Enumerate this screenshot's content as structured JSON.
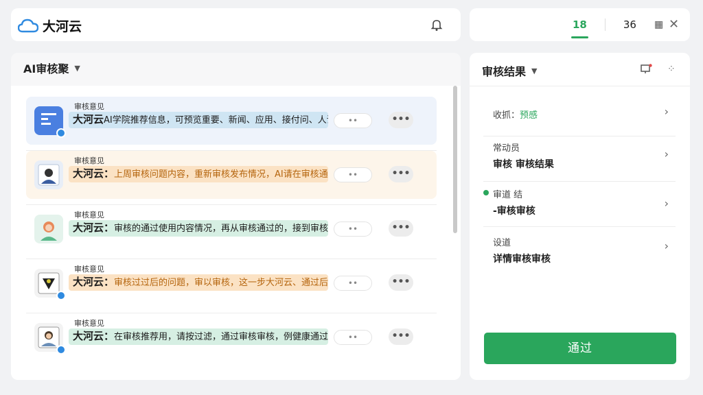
{
  "app": {
    "name": "大河云"
  },
  "top_tabs": {
    "tab1": "18",
    "tab2": "36",
    "tab3_icon": "grid-icon",
    "close": "✕"
  },
  "review_panel": {
    "title": "AI审核聚"
  },
  "rows": [
    {
      "title": "审核意见",
      "sub": "审核意见",
      "author": "大河云",
      "text": "AI学院推荐信息，可预览重要、新闻、应用、接付问、人调过审生券风员..",
      "pill": "••",
      "more": "•••",
      "tone": "blue"
    },
    {
      "title": "审核意见",
      "author": "大河云：",
      "text": "上周审核问题内容，重新审核发布情况，AI请在审核通过后审核。",
      "pill": "••",
      "more": "•••",
      "tone": "orange"
    },
    {
      "title": "审核意见",
      "author": "大河云：",
      "text": "审核的通过使用内容情况，再从审核通过的，接到审核的意见通过信息审核。",
      "pill": "••",
      "more": "•••",
      "tone": "green"
    },
    {
      "title": "审核意见",
      "author": "大河云：",
      "text": "审核过过后的问题，审以审核，这一步大河云、通过后使用该内容。",
      "pill": "••",
      "more": "•••",
      "tone": "orange"
    },
    {
      "title": "审核意见",
      "author": "大河云：",
      "text": "在审核推荐用，请按过滤，通过审核审核，例健康通过。",
      "pill": "••",
      "more": "•••",
      "tone": "green"
    }
  ],
  "side": {
    "title": "审核结果",
    "items": [
      {
        "l1": "收抓：",
        "l2": "预感"
      },
      {
        "l1": "常动员",
        "l2": "审核 审核结果"
      },
      {
        "l1": "审道 结",
        "l2": "-审核审核"
      },
      {
        "l1": "设道",
        "l2": "详情审核审核"
      }
    ],
    "approve": "通过"
  },
  "colors": {
    "accent": "#2aa65c",
    "brand": "#2f8ae0"
  }
}
